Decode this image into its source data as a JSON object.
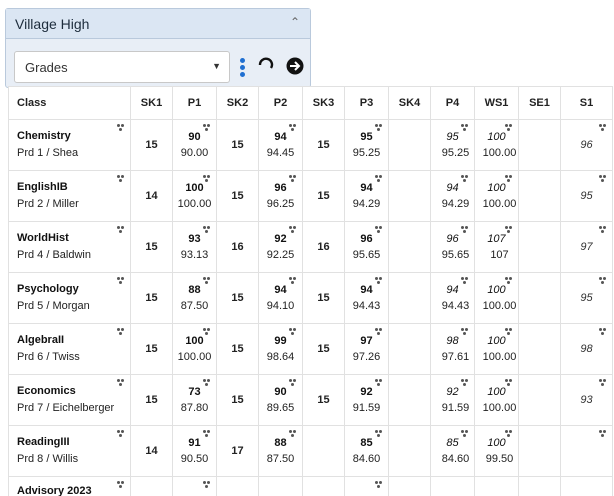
{
  "school": {
    "name": "Village High"
  },
  "term_select": {
    "value": "Grades"
  },
  "columns": [
    "Class",
    "SK1",
    "P1",
    "SK2",
    "P2",
    "SK3",
    "P3",
    "SK4",
    "P4",
    "WS1",
    "SE1",
    "S1"
  ],
  "rows": [
    {
      "name": "Chemistry",
      "period": "Prd 1 / Shea",
      "sk1": "15",
      "p1_score": "90",
      "p1_pct": "90.00",
      "sk2": "15",
      "p2_score": "94",
      "p2_pct": "94.45",
      "sk3": "15",
      "p3_score": "95",
      "p3_pct": "95.25",
      "sk4": "",
      "p4_score": "95",
      "p4_pct": "95.25",
      "ws1_score": "100",
      "ws1_pct": "100.00",
      "se1": "",
      "s1": "96"
    },
    {
      "name": "EnglishIB",
      "period": "Prd 2 / Miller",
      "sk1": "14",
      "p1_score": "100",
      "p1_pct": "100.00",
      "sk2": "15",
      "p2_score": "96",
      "p2_pct": "96.25",
      "sk3": "15",
      "p3_score": "94",
      "p3_pct": "94.29",
      "sk4": "",
      "p4_score": "94",
      "p4_pct": "94.29",
      "ws1_score": "100",
      "ws1_pct": "100.00",
      "se1": "",
      "s1": "95"
    },
    {
      "name": "WorldHist",
      "period": "Prd 4 / Baldwin",
      "sk1": "15",
      "p1_score": "93",
      "p1_pct": "93.13",
      "sk2": "16",
      "p2_score": "92",
      "p2_pct": "92.25",
      "sk3": "16",
      "p3_score": "96",
      "p3_pct": "95.65",
      "sk4": "",
      "p4_score": "96",
      "p4_pct": "95.65",
      "ws1_score": "107",
      "ws1_pct": "107",
      "se1": "",
      "s1": "97"
    },
    {
      "name": "Psychology",
      "period": "Prd 5 / Morgan",
      "sk1": "15",
      "p1_score": "88",
      "p1_pct": "87.50",
      "sk2": "15",
      "p2_score": "94",
      "p2_pct": "94.10",
      "sk3": "15",
      "p3_score": "94",
      "p3_pct": "94.43",
      "sk4": "",
      "p4_score": "94",
      "p4_pct": "94.43",
      "ws1_score": "100",
      "ws1_pct": "100.00",
      "se1": "",
      "s1": "95"
    },
    {
      "name": "AlgebraII",
      "period": "Prd 6 / Twiss",
      "sk1": "15",
      "p1_score": "100",
      "p1_pct": "100.00",
      "sk2": "15",
      "p2_score": "99",
      "p2_pct": "98.64",
      "sk3": "15",
      "p3_score": "97",
      "p3_pct": "97.26",
      "sk4": "",
      "p4_score": "98",
      "p4_pct": "97.61",
      "ws1_score": "100",
      "ws1_pct": "100.00",
      "se1": "",
      "s1": "98"
    },
    {
      "name": "Economics",
      "period": "Prd 7 / Eichelberger",
      "sk1": "15",
      "p1_score": "73",
      "p1_pct": "87.80",
      "sk2": "15",
      "p2_score": "90",
      "p2_pct": "89.65",
      "sk3": "15",
      "p3_score": "92",
      "p3_pct": "91.59",
      "sk4": "",
      "p4_score": "92",
      "p4_pct": "91.59",
      "ws1_score": "100",
      "ws1_pct": "100.00",
      "se1": "",
      "s1": "93"
    },
    {
      "name": "ReadingIII",
      "period": "Prd 8 / Willis",
      "sk1": "14",
      "p1_score": "91",
      "p1_pct": "90.50",
      "sk2": "17",
      "p2_score": "88",
      "p2_pct": "87.50",
      "sk3": "",
      "p3_score": "85",
      "p3_pct": "84.60",
      "sk4": "",
      "p4_score": "85",
      "p4_pct": "84.60",
      "ws1_score": "100",
      "ws1_pct": "99.50",
      "se1": "",
      "s1": ""
    }
  ],
  "partial_row": {
    "name": "Advisory 2023"
  }
}
